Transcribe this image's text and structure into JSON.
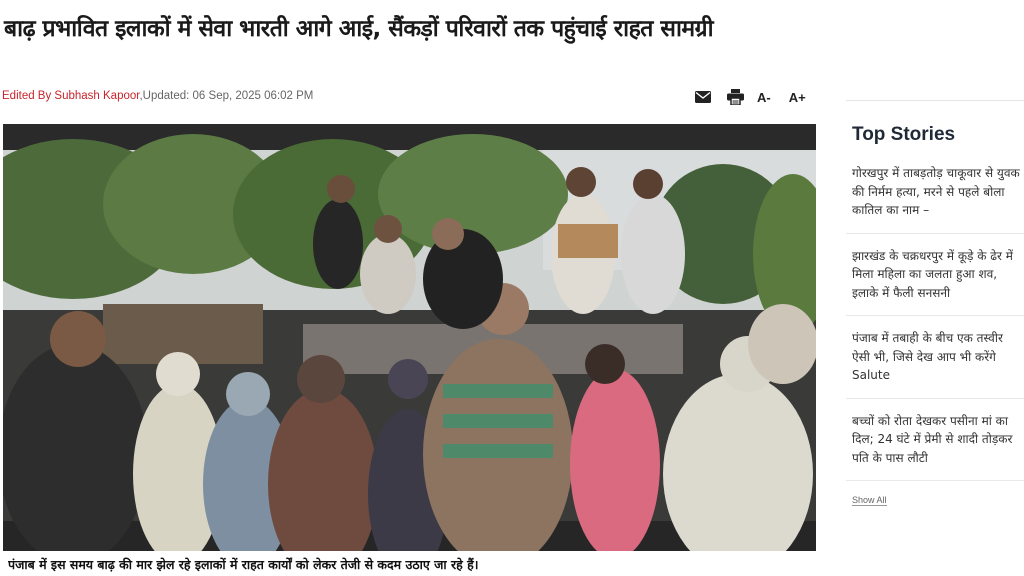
{
  "article": {
    "headline": "बाढ़ प्रभावित इलाकों में सेवा भारती आगे आई, सैंकड़ों परिवारों तक पहुंचाई राहत सामग्री",
    "editor": "Edited By Subhash Kapoor",
    "updated": ",Updated: 06 Sep, 2025 06:02 PM",
    "caption": "पंजाब में इस समय बाढ़ की मार झेल रहे इलाकों में राहत कार्यों को लेकर तेजी से कदम उठाए जा रहे हैं।"
  },
  "toolbar": {
    "email_icon": "email-icon",
    "print_icon": "print-icon",
    "font_decrease": "A-",
    "font_increase": "A+"
  },
  "sidebar": {
    "title": "Top Stories",
    "stories": [
      {
        "text": "गोरखपुर में ताबड़तोड़ चाकूवार से युवक की निर्मम हत्या, मरने से पहले बोला कातिल का नाम –"
      },
      {
        "text": "झारखंड के चक्रधरपुर में कूड़े के ढेर में मिला महिला का जलता हुआ शव, इलाके में फैली सनसनी"
      },
      {
        "text": "पंजाब में तबाही के बीच एक तस्वीर ऐसी भी, जिसे देख आप भी करेंगे Salute"
      },
      {
        "text": "बच्चों को रोता देखकर पसीना मां का दिल; 24 घंटे में प्रेमी से शादी तोड़कर पति के पास लौटी"
      }
    ],
    "show_all": "Show All"
  },
  "colors": {
    "editor": "#c8242b",
    "headline": "#1a1a1a",
    "sidebar_title": "#1f2937"
  }
}
